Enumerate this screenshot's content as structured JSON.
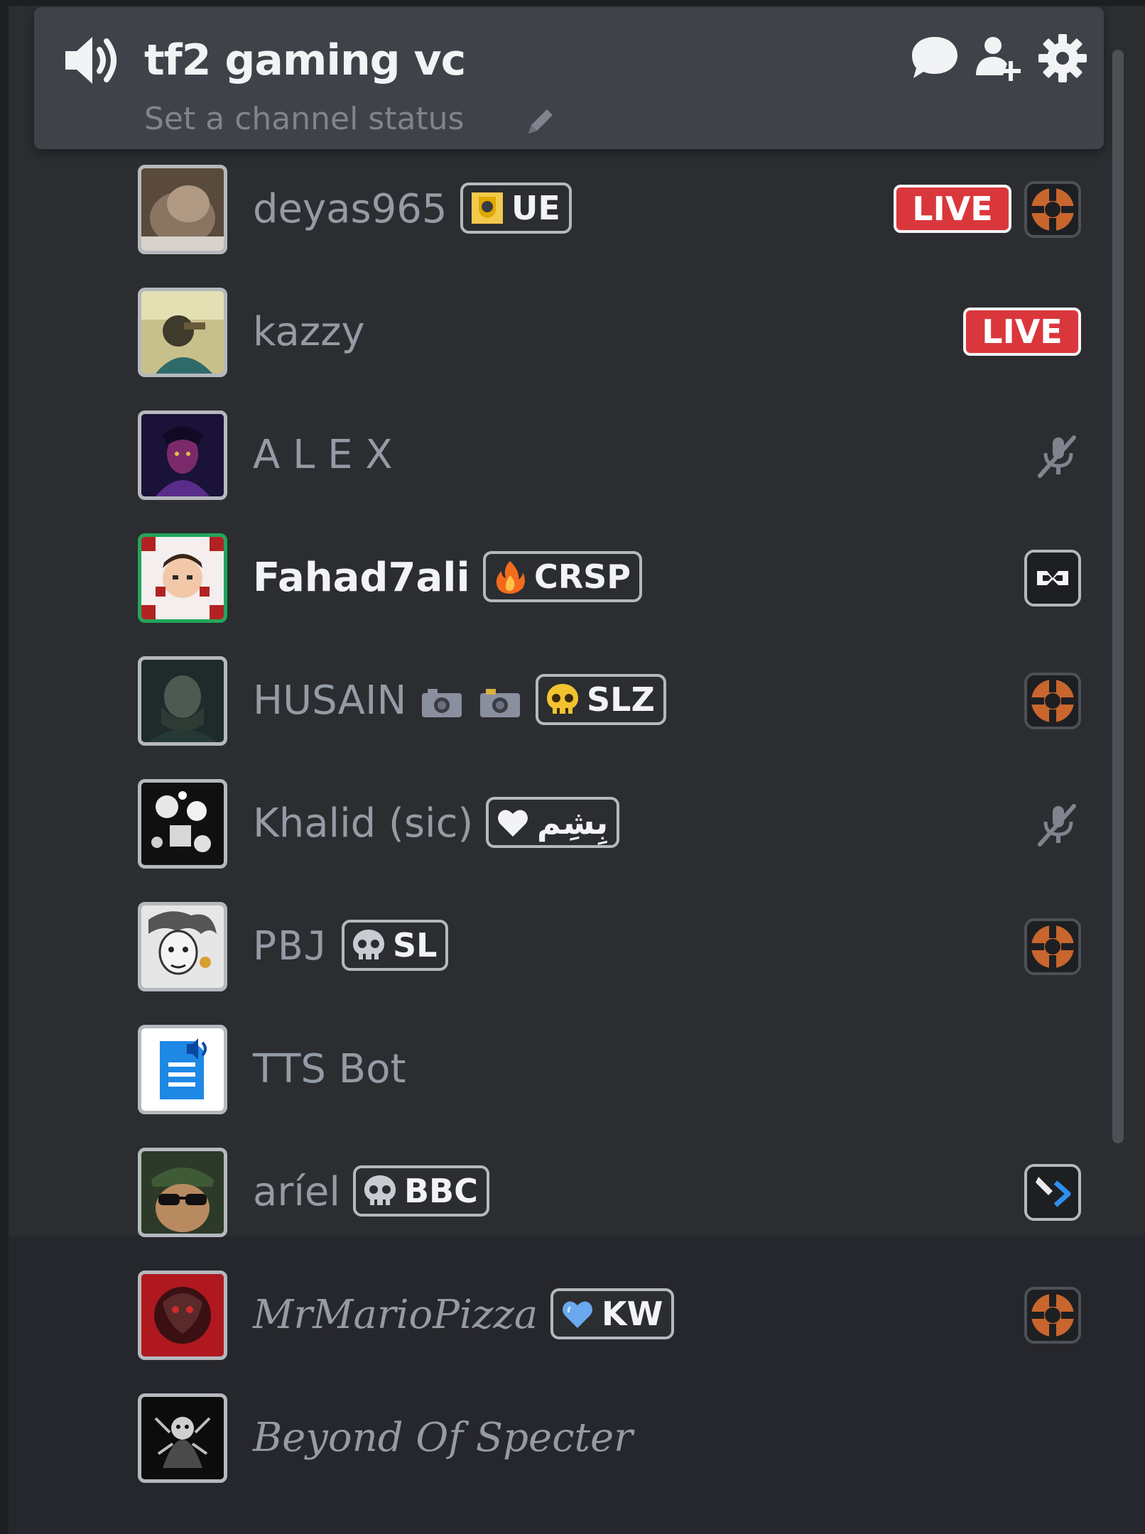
{
  "channel": {
    "name": "tf2 gaming vc",
    "status_placeholder": "Set a channel status"
  },
  "members": [
    {
      "name": "deyas965",
      "tag": "UE",
      "tag_icon": "trophy-badge-icon",
      "live": "LIVE",
      "activity": "tf2-logo-icon"
    },
    {
      "name": "kazzy",
      "live": "LIVE"
    },
    {
      "name": "A L E X",
      "status_icon": "deafened-mic-icon"
    },
    {
      "name": "Fahad7ali",
      "tag": "CRSP",
      "tag_icon": "fire-icon",
      "activity": "game-logo-icon",
      "speaking": true
    },
    {
      "name": "HUSAIN",
      "name_suffix": "📷 📷",
      "tag": "SLZ",
      "tag_icon": "skull-gold-icon",
      "activity": "tf2-logo-icon"
    },
    {
      "name": "Khalid (sic)",
      "tag": "بِشِم",
      "tag_icon": "heart-white-icon",
      "status_icon": "deafened-mic-icon"
    },
    {
      "name": "PBJ",
      "tag": "SL",
      "tag_icon": "skull-gray-icon",
      "activity": "tf2-logo-icon"
    },
    {
      "name": "TTS Bot"
    },
    {
      "name": "aríel",
      "tag": "BBC",
      "tag_icon": "skull-gray-icon",
      "activity": "vscode-icon"
    },
    {
      "name": "MrMarioPizza",
      "tag": "KW",
      "tag_icon": "heart-blue-icon",
      "activity": "tf2-logo-icon"
    },
    {
      "name": "Beyond Of Specter"
    }
  ],
  "colors": {
    "background": "#2b2d31",
    "card": "#404249",
    "live": "#da373c",
    "speaking": "#23a55a",
    "tf2_orange": "#c8662e"
  }
}
